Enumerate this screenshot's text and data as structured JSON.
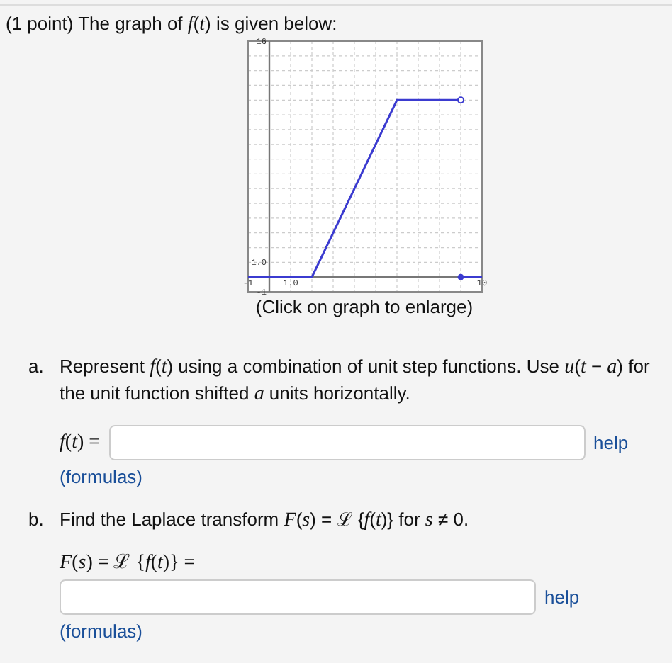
{
  "intro": "(1 point) The graph of *f*(*t*) is given below:",
  "graph": {
    "caption": "(Click on graph to enlarge)",
    "chart_data": {
      "type": "line",
      "x": [
        -1,
        2,
        6,
        9,
        10
      ],
      "series": [
        {
          "color": "#3b3bd0",
          "values": [
            0,
            0,
            12,
            12,
            null
          ]
        },
        {
          "color": "#3b3bd0",
          "values": [
            null,
            null,
            null,
            0,
            0
          ]
        }
      ],
      "xlim": [
        -1,
        10
      ],
      "ylim": [
        -1,
        16
      ],
      "xticks": [
        {
          "value": -1,
          "label": "-1"
        },
        {
          "value": 1,
          "label": "1.0"
        },
        {
          "value": 10,
          "label": "10"
        }
      ],
      "yticks": [
        {
          "value": -1,
          "label": "-1"
        },
        {
          "value": 1,
          "label": "1.0"
        },
        {
          "value": 16,
          "label": "16"
        }
      ]
    }
  },
  "parts": [
    {
      "marker": "a.",
      "text": "Represent *f*(*t*) using a combination of unit step functions. Use *u*(*t* − *a*) for the unit function shifted *a* units horizontally.",
      "answer_label": "*f*(*t*) =",
      "label_inline": true,
      "help": "help",
      "formulas": "(formulas)"
    },
    {
      "marker": "b.",
      "text": "Find the Laplace transform *F*(*s*) = ℒ {*f*(*t*)} for *s* ≠ 0.",
      "answer_label": "*F*(*s*) = ℒ {*f*(*t*)} =",
      "label_inline": false,
      "help": "help",
      "formulas": "(formulas)"
    }
  ]
}
